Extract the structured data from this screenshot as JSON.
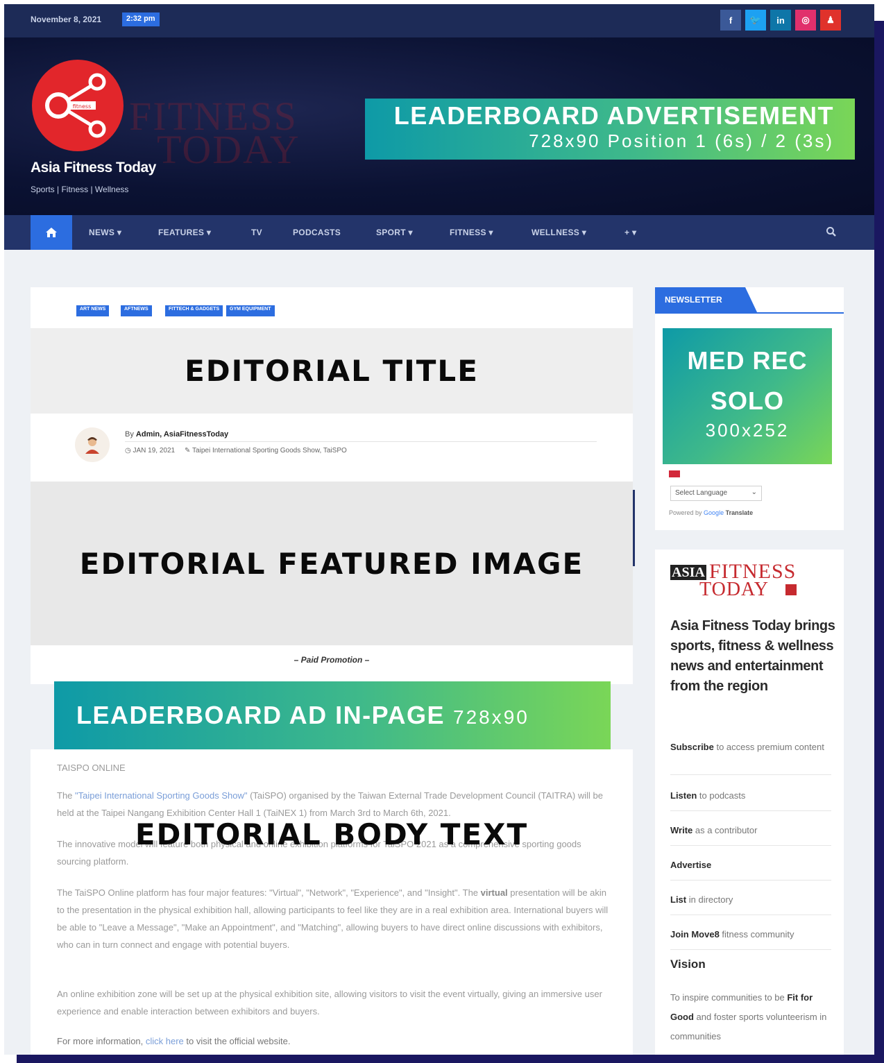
{
  "topbar": {
    "date": "November 8, 2021",
    "time": "2:32 pm",
    "social": [
      {
        "label": "f",
        "color": "#3b5998",
        "name": "facebook-icon"
      },
      {
        "label": "🐦",
        "color": "#1da1f2",
        "name": "twitter-icon"
      },
      {
        "label": "in",
        "color": "#0e76a8",
        "name": "linkedin-icon"
      },
      {
        "label": "◎",
        "color": "#e1306c",
        "name": "instagram-icon"
      },
      {
        "label": "♟",
        "color": "#e0322b",
        "name": "youtube-icon"
      }
    ]
  },
  "header": {
    "site_title": "Asia Fitness Today",
    "tagline": "Sports | Fitness | Wellness",
    "logo_inner_text": "fitness",
    "bg_word1": "FITNESS",
    "bg_word2": "TODAY",
    "ad_title": "LEADERBOARD ADVERTISEMENT",
    "ad_subtitle": "728x90 Position 1 (6s) / 2 (3s)"
  },
  "nav": {
    "items": [
      "NEWS ▾",
      "FEATURES ▾",
      "TV",
      "PODCASTS",
      "SPORT ▾",
      "FITNESS ▾",
      "WELLNESS ▾",
      "+ ▾"
    ]
  },
  "article": {
    "categories": [
      "ART NEWS",
      "AFTNEWS",
      "FITTECH & GADGETS",
      "GYM EQUIPMENT"
    ],
    "title_placeholder": "EDITORIAL TITLE",
    "by_prefix": "By",
    "author": "Admin, AsiaFitnessToday",
    "date": "JAN 19, 2021",
    "tags": "Taipei International Sporting Goods Show, TaiSPO",
    "image_placeholder": "EDITORIAL FEATURED IMAGE",
    "paid_promotion": "– Paid Promotion –",
    "inpage_ad_title": "LEADERBOARD AD IN-PAGE",
    "inpage_ad_size": "728x90",
    "body_placeholder": "EDITORIAL BODY TEXT",
    "body_heading": "TAISPO ONLINE",
    "p1_before": "The ",
    "p1_link": "\"Taipei International Sporting Goods Show\"",
    "p1_after": " (TaiSPO) organised by the Taiwan External Trade Development Council (TAITRA) will be held at the Taipei Nangang Exhibition Center Hall 1 (TaiNEX 1) from March 3rd to March 6th, 2021.",
    "p2": "The innovative model will feature both physical and online exhibition platforms for TaiSPO 2021 as a comprehensive sporting goods sourcing platform.",
    "p3_before": "The TaiSPO Online platform has four major features: \"Virtual\", \"Network\", \"Experience\", and \"Insight\". The ",
    "p3_bold": "virtual",
    "p3_after": " presentation will be akin to the presentation in the physical exhibition hall, allowing participants to feel like they are in a real exhibition area. International buyers will be able to \"Leave a Message\", \"Make an Appointment\", and \"Matching\", allowing buyers to have direct online discussions with exhibitors, who can in turn connect and engage with potential buyers.",
    "p4": "An online exhibition zone will be set up at the physical exhibition site, allowing visitors to visit the event virtually, giving an immersive user experience and enable interaction between exhibitors and buyers.",
    "p5_before": "For more information, ",
    "p5_link": "click here",
    "p5_after": " to visit the official website."
  },
  "sidebar": {
    "newsletter_tab": "NEWSLETTER",
    "medrec_title": "MED REC SOLO",
    "medrec_size": "300x252",
    "language_select": "Select Language",
    "powered_by": "Powered by",
    "google": "Google",
    "translate": "Translate",
    "brand_asia": "ASIA",
    "brand_fitness": "FITNESS",
    "brand_today": "TODAY",
    "about_heading": "Asia Fitness Today brings sports, fitness & wellness news and entertainment from the region",
    "links": [
      {
        "bold": "Subscribe",
        "rest": " to access premium content"
      },
      {
        "bold": "Listen",
        "rest": " to podcasts"
      },
      {
        "bold": "Write",
        "rest": " as a contributor"
      },
      {
        "bold": "Advertise",
        "rest": ""
      },
      {
        "bold": "List",
        "rest": " in directory"
      },
      {
        "bold": "Join Move8",
        "rest": " fitness community"
      }
    ],
    "vision_title": "Vision",
    "vision_before": "To inspire communities to be ",
    "vision_bold": "Fit for Good",
    "vision_after": " and foster sports volunteerism in communities"
  }
}
